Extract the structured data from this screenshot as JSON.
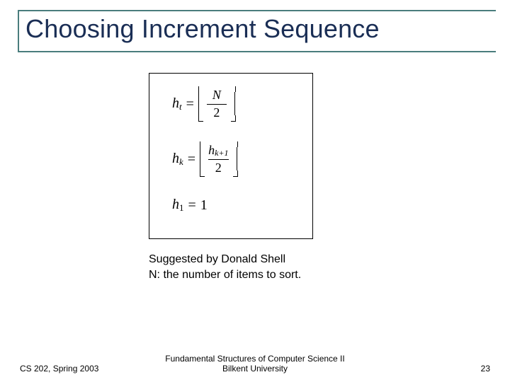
{
  "title": "Choosing Increment Sequence",
  "formulas": {
    "eq1": {
      "lhs_var": "h",
      "lhs_sub": "t",
      "num": "N",
      "den": "2"
    },
    "eq2": {
      "lhs_var": "h",
      "lhs_sub": "k",
      "num_var": "h",
      "num_sub": "k+1",
      "den": "2"
    },
    "eq3": {
      "lhs_var": "h",
      "lhs_sub": "1",
      "rhs": "1"
    }
  },
  "body": {
    "line1": "Suggested by Donald Shell",
    "line2": "N: the number of items to sort."
  },
  "footer": {
    "left": "CS 202, Spring 2003",
    "center_line1": "Fundamental Structures of Computer Science II",
    "center_line2": "Bilkent University",
    "page": "23"
  }
}
